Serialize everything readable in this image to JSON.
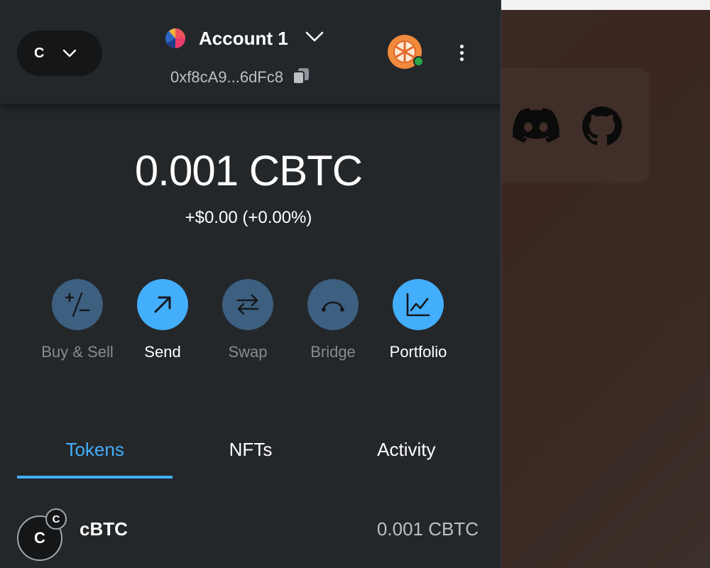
{
  "network": {
    "letter": "C"
  },
  "account": {
    "name": "Account 1",
    "address": "0xf8cA9...6dFc8"
  },
  "balance": {
    "amount": "0.001 CBTC",
    "change": "+$0.00 (+0.00%)"
  },
  "actions": [
    {
      "label": "Buy & Sell",
      "state": "disabled"
    },
    {
      "label": "Send",
      "state": "active"
    },
    {
      "label": "Swap",
      "state": "disabled"
    },
    {
      "label": "Bridge",
      "state": "disabled"
    },
    {
      "label": "Portfolio",
      "state": "active"
    }
  ],
  "tabs": [
    {
      "label": "Tokens",
      "active": true
    },
    {
      "label": "NFTs",
      "active": false
    },
    {
      "label": "Activity",
      "active": false
    }
  ],
  "tokens": [
    {
      "icon_letter": "C",
      "badge_letter": "C",
      "name": "cBTC",
      "balance": "0.001 CBTC"
    }
  ],
  "icons": {
    "network_chevron": "chevron-down-icon",
    "account_chevron": "chevron-down-icon",
    "copy": "copy-icon",
    "menu": "kebab-menu-icon",
    "social": [
      "discord-icon",
      "github-icon"
    ]
  },
  "colors": {
    "accent": "#43aefc",
    "accent_disabled": "#3d5f80",
    "panel": "#24272a",
    "status_online": "#28a745"
  }
}
